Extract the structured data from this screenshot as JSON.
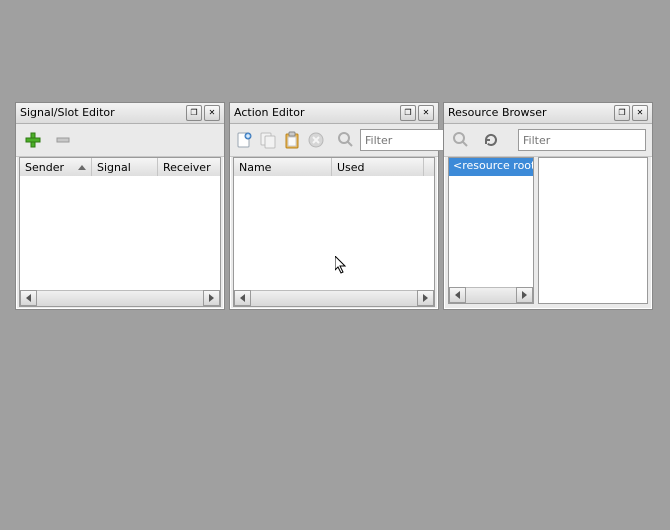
{
  "panels": {
    "signal_slot": {
      "title": "Signal/Slot Editor",
      "columns": {
        "sender": "Sender",
        "signal": "Signal",
        "receiver": "Receiver"
      }
    },
    "action_editor": {
      "title": "Action Editor",
      "filter_placeholder": "Filter",
      "columns": {
        "name": "Name",
        "used": "Used"
      }
    },
    "resource_browser": {
      "title": "Resource Browser",
      "filter_placeholder": "Filter",
      "root_item": "<resource root>"
    }
  },
  "icons": {
    "restore": "❐",
    "close": "✕"
  }
}
